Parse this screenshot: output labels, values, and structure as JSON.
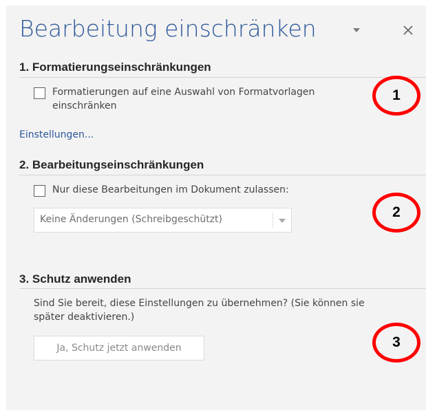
{
  "pane": {
    "title": "Bearbeitung einschränken",
    "menu_icon": "chevron-down-icon",
    "close_icon": "close-icon",
    "close_glyph": "✕"
  },
  "sections": [
    {
      "header": "1. Formatierungseinschränkungen",
      "checkbox_label_line1": "Formatierungen auf eine Auswahl von Formatvorlagen",
      "checkbox_label_line2": "einschränken",
      "checked": false,
      "link": "Einstellungen..."
    },
    {
      "header": "2. Bearbeitungseinschränkungen",
      "checkbox_label": "Nur diese Bearbeitungen im Dokument zulassen:",
      "checked": false,
      "dropdown_value": "Keine Änderungen (Schreibgeschützt)"
    },
    {
      "header": "3. Schutz anwenden",
      "description_line1": "Sind Sie bereit, diese Einstellungen zu übernehmen? (Sie können sie",
      "description_line2": "später deaktivieren.)",
      "button": "Ja, Schutz jetzt anwenden"
    }
  ],
  "annotations": [
    {
      "label": "1",
      "color": "#ff0000"
    },
    {
      "label": "2",
      "color": "#ff0000"
    },
    {
      "label": "3",
      "color": "#ff0000"
    }
  ],
  "colors": {
    "pane_background": "#f3f3f3",
    "title_accent": "#2b579a",
    "link": "#2b579a",
    "marker_ring": "#ff0000"
  }
}
